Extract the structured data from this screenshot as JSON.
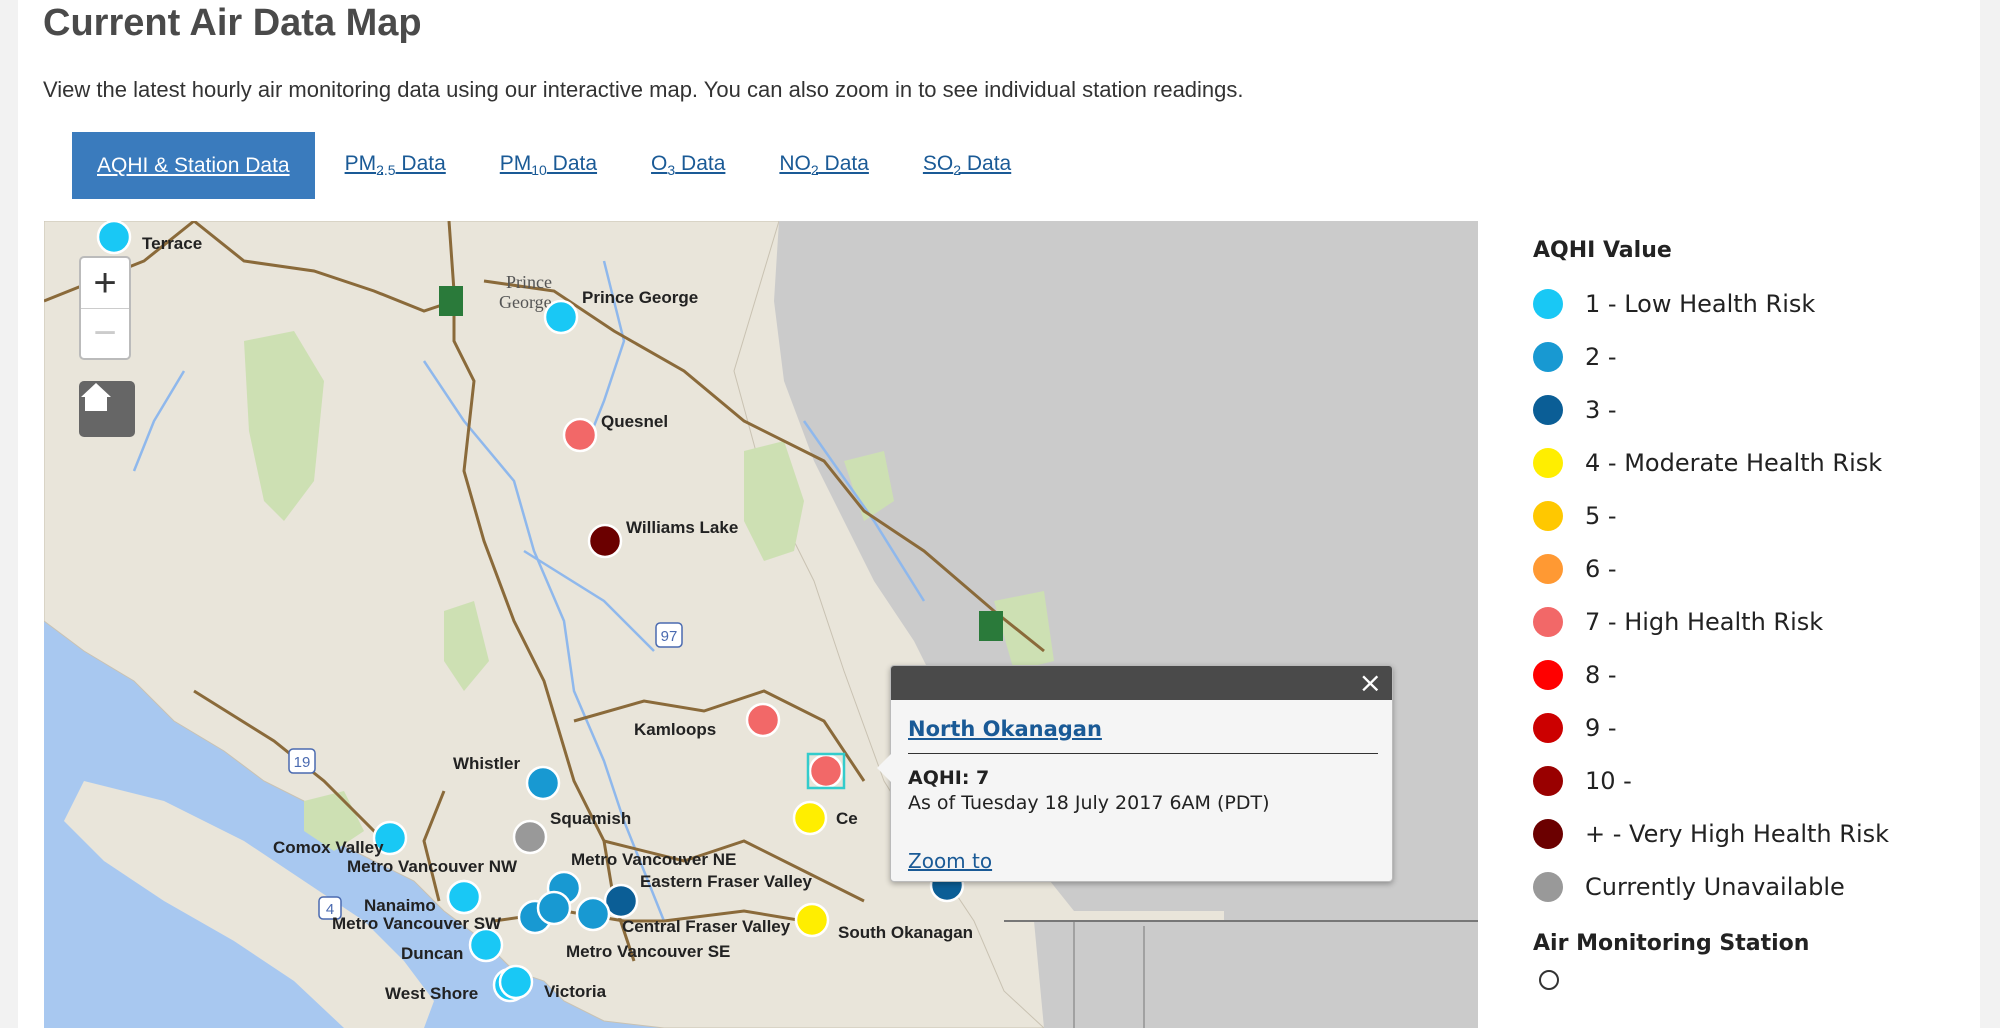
{
  "page": {
    "title": "Current Air Data Map",
    "intro": "View the latest hourly air monitoring data using our interactive map. You can also zoom in to see individual station readings."
  },
  "tabs": [
    {
      "label": "AQHI & Station Data",
      "base": "AQHI & Station Data",
      "sub": "",
      "suffix": "",
      "active": true
    },
    {
      "label": "PM2.5 Data",
      "base": "PM",
      "sub": "2.5",
      "suffix": " Data",
      "active": false
    },
    {
      "label": "PM10 Data",
      "base": "PM",
      "sub": "10",
      "suffix": " Data",
      "active": false
    },
    {
      "label": "O3 Data",
      "base": "O",
      "sub": "3",
      "suffix": " Data",
      "active": false
    },
    {
      "label": "NO2 Data",
      "base": "NO",
      "sub": "2",
      "suffix": " Data",
      "active": false
    },
    {
      "label": "SO2 Data",
      "base": "SO",
      "sub": "2",
      "suffix": " Data",
      "active": false
    }
  ],
  "map": {
    "controls": {
      "zoom_in": "+",
      "zoom_out": "−",
      "home_icon": "home-icon"
    },
    "place_labels": [
      "Prince",
      "George"
    ],
    "highway_shields": [
      "97",
      "19",
      "4"
    ],
    "stations": [
      {
        "name": "Terrace",
        "color": "#19c8f5"
      },
      {
        "name": "Prince George",
        "color": "#19c8f5"
      },
      {
        "name": "Quesnel",
        "color": "#f26868"
      },
      {
        "name": "Williams Lake",
        "color": "#6b0000"
      },
      {
        "name": "Kamloops",
        "color": "#f26868"
      },
      {
        "name": "Whistler",
        "color": "#1899d2"
      },
      {
        "name": "Squamish",
        "color": "#999999"
      },
      {
        "name": "Comox Valley",
        "color": "#19c8f5"
      },
      {
        "name": "Metro Vancouver NW",
        "color": "#19c8f5"
      },
      {
        "name": "Metro Vancouver NE",
        "color": "#1899d2"
      },
      {
        "name": "Eastern Fraser Valley",
        "color": "#0b5e96"
      },
      {
        "name": "Nanaimo",
        "color": "#19c8f5"
      },
      {
        "name": "Metro Vancouver SW",
        "color": "#1899d2"
      },
      {
        "name": "Central Fraser Valley",
        "color": "#1899d2"
      },
      {
        "name": "Metro Vancouver SE",
        "color": "#1899d2"
      },
      {
        "name": "Duncan",
        "color": "#19c8f5"
      },
      {
        "name": "West Shore",
        "color": "#19c8f5"
      },
      {
        "name": "Victoria",
        "color": "#19c8f5"
      },
      {
        "name": "North Okanagan",
        "color": "#f26868"
      },
      {
        "name": "Ce",
        "color": "#ffee00"
      },
      {
        "name": "South Okanagan",
        "color": "#ffee00"
      },
      {
        "name": "",
        "color": "#0b5e96"
      }
    ]
  },
  "popup": {
    "station": "North Okanagan",
    "aqhi": "AQHI: 7",
    "as_of": "As of Tuesday 18 July 2017 6AM (PDT)",
    "zoom_link": "Zoom to",
    "close": "×"
  },
  "legend": {
    "title": "AQHI Value",
    "items": [
      {
        "label": "1 - Low Health Risk",
        "color": "#19c8f5"
      },
      {
        "label": "2 -",
        "color": "#1899d2"
      },
      {
        "label": "3 -",
        "color": "#0b5e96"
      },
      {
        "label": "4 - Moderate Health Risk",
        "color": "#ffee00"
      },
      {
        "label": "5 -",
        "color": "#ffc800"
      },
      {
        "label": "6 -",
        "color": "#ff9933"
      },
      {
        "label": "7 - High Health Risk",
        "color": "#f26868"
      },
      {
        "label": "8 -",
        "color": "#ff0000"
      },
      {
        "label": "9 -",
        "color": "#cc0000"
      },
      {
        "label": "10 -",
        "color": "#990000"
      },
      {
        "label": "+ - Very High Health Risk",
        "color": "#6b0000"
      },
      {
        "label": "Currently Unavailable",
        "color": "#999999"
      }
    ],
    "station_title": "Air Monitoring Station"
  }
}
